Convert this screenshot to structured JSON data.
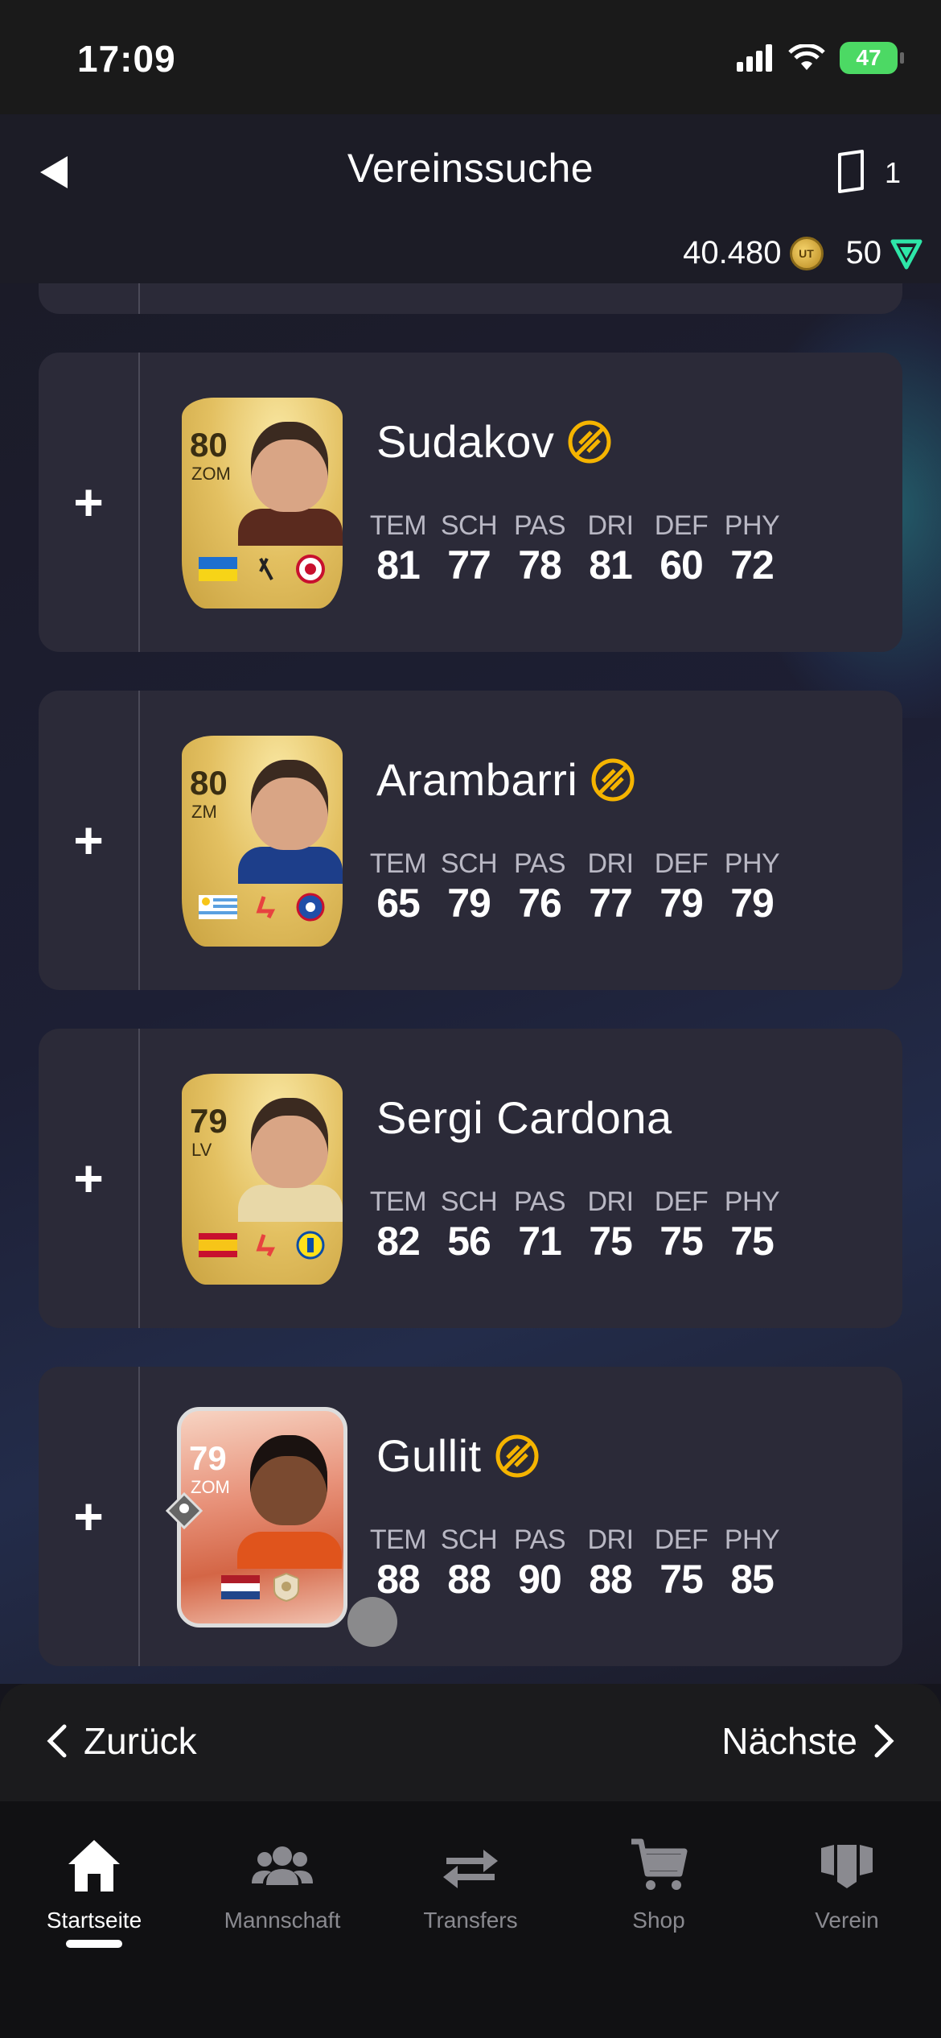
{
  "status_bar": {
    "time": "17:09",
    "battery": "47"
  },
  "header": {
    "title": "Vereinssuche",
    "card_count": "1"
  },
  "currency": {
    "coins": "40.480",
    "coin_icon_text": "UT",
    "points": "50"
  },
  "stat_labels": [
    "TEM",
    "SCH",
    "PAS",
    "DRI",
    "DEF",
    "PHY"
  ],
  "players": [
    {
      "name": "Sudakov",
      "rating": "80",
      "position": "ZOM",
      "untradeable": true,
      "stats": [
        "81",
        "77",
        "78",
        "81",
        "60",
        "72"
      ],
      "card_type": "gold",
      "nation": "ukraine",
      "league": "liga-portugal",
      "club": "benfica"
    },
    {
      "name": "Arambarri",
      "rating": "80",
      "position": "ZM",
      "untradeable": true,
      "stats": [
        "65",
        "79",
        "76",
        "77",
        "79",
        "79"
      ],
      "card_type": "gold",
      "nation": "uruguay",
      "league": "laliga",
      "club": "getafe"
    },
    {
      "name": "Sergi Cardona",
      "rating": "79",
      "position": "LV",
      "untradeable": false,
      "stats": [
        "82",
        "56",
        "71",
        "75",
        "75",
        "75"
      ],
      "card_type": "gold",
      "nation": "spain",
      "league": "laliga",
      "club": "villarreal"
    },
    {
      "name": "Gullit",
      "rating": "79",
      "position": "ZOM",
      "untradeable": true,
      "stats": [
        "88",
        "88",
        "90",
        "88",
        "75",
        "85"
      ],
      "card_type": "icon",
      "nation": "netherlands",
      "league": "icons",
      "club": "icon"
    }
  ],
  "pagination": {
    "prev_label": "Zurück",
    "next_label": "Nächste"
  },
  "tabs": [
    {
      "label": "Startseite",
      "icon": "home-icon",
      "active": true
    },
    {
      "label": "Mannschaft",
      "icon": "team-icon",
      "active": false
    },
    {
      "label": "Transfers",
      "icon": "transfer-icon",
      "active": false
    },
    {
      "label": "Shop",
      "icon": "cart-icon",
      "active": false
    },
    {
      "label": "Verein",
      "icon": "club-icon",
      "active": false
    }
  ],
  "colors": {
    "accent_untradeable": "#f5b400",
    "card_bg": "#2b2a38",
    "points_green": "#2ee6a8"
  }
}
